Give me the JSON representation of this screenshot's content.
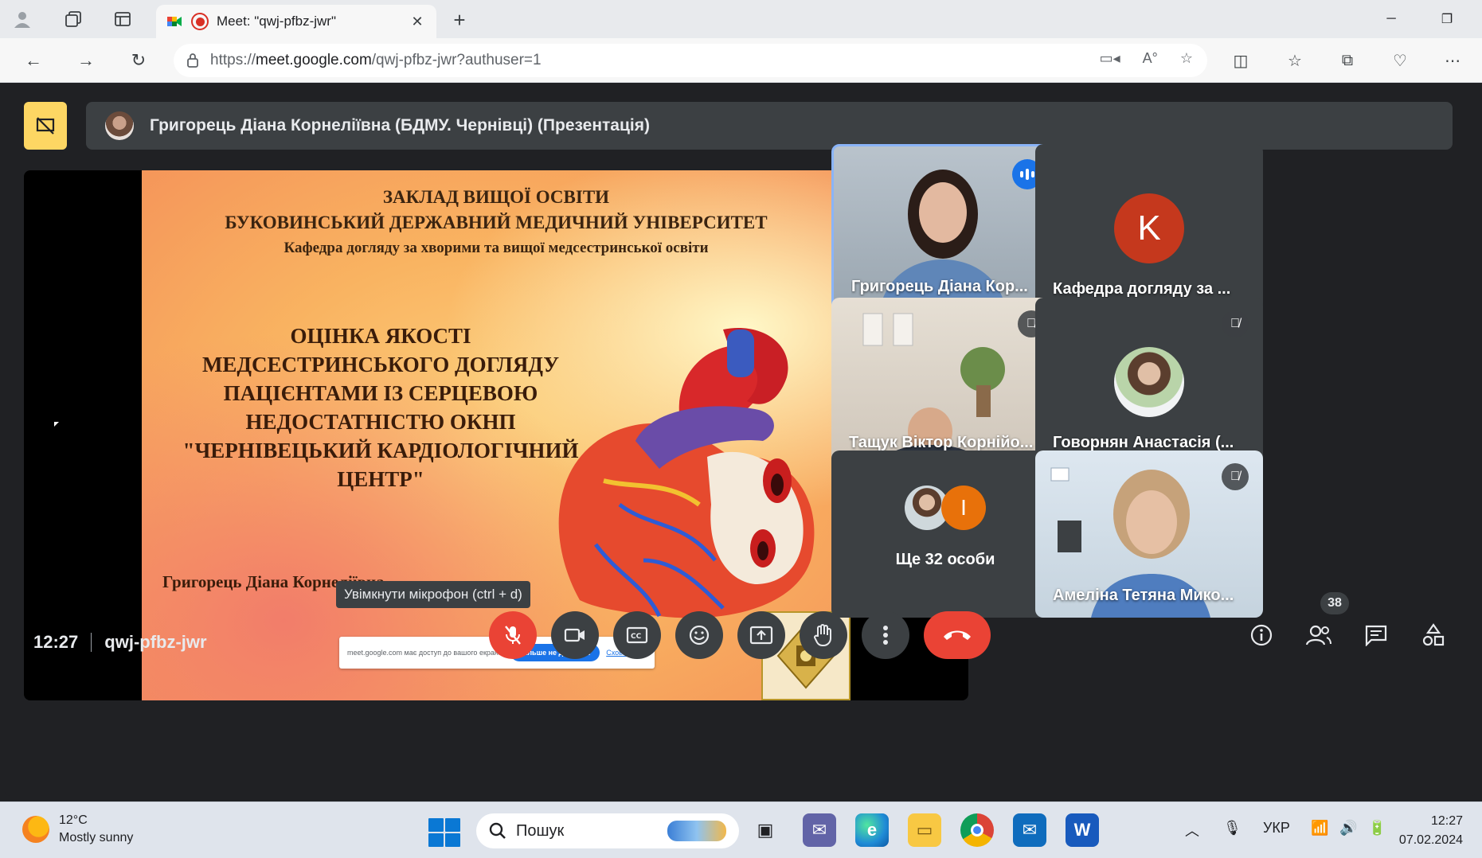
{
  "browser": {
    "tab_title": "Meet: \"qwj-pfbz-jwr\"",
    "url_prefix": "https://",
    "url_domain": "meet.google.com",
    "url_path": "/qwj-pfbz-jwr?authuser=1"
  },
  "meet": {
    "presenter_banner": "Григорець Діана Корнеліївна (БДМУ. Чернівці) (Презентація)",
    "slide": {
      "header_line1": "ЗАКЛАД ВИЩОЇ ОСВІТИ",
      "header_line2": "БУКОВИНСЬКИЙ ДЕРЖАВНИЙ МЕДИЧНИЙ УНІВЕРСИТЕТ",
      "header_line3": "Кафедра догляду за хворими та вищої медсестринської освіти",
      "title_line1": "ОЦІНКА ЯКОСТІ",
      "title_line2": "МЕДСЕСТРИНСЬКОГО ДОГЛЯДУ",
      "title_line3": "ПАЦІЄНТАМИ ІЗ СЕРЦЕВОЮ",
      "title_line4": "НЕДОСТАТНІСТЮ ОКНП",
      "title_line5": "\"ЧЕРНІВЕЦЬКИЙ КАРДІОЛОГІЧНИЙ",
      "title_line6": "ЦЕНТР\"",
      "author": "Григорець Діана Корнеліївна",
      "share_notice_text": "meet.google.com має доступ до вашого екрана.",
      "share_stop_label": "Більше не ділитися",
      "share_hide_label": "Сховати"
    },
    "tiles": [
      {
        "name": "Григорець Діана Кор..."
      },
      {
        "name": "Кафедра догляду за ...",
        "avatar_letter": "K"
      },
      {
        "name": "Тащук Віктор Корнійо..."
      },
      {
        "name": "Говорнян Анастасія (..."
      },
      {
        "name": "Ще 32 особи",
        "avatar_letter": "I"
      },
      {
        "name": "Амеліна Тетяна Мико..."
      }
    ],
    "time": "12:27",
    "meeting_code": "qwj-pfbz-jwr",
    "mic_tooltip": "Увімкнути мікрофон (ctrl + d)",
    "participants_count": "38"
  },
  "taskbar": {
    "temperature": "12°C",
    "weather": "Mostly sunny",
    "search_placeholder": "Пошук",
    "language": "УКР",
    "clock_time": "12:27",
    "clock_date": "07.02.2024"
  }
}
